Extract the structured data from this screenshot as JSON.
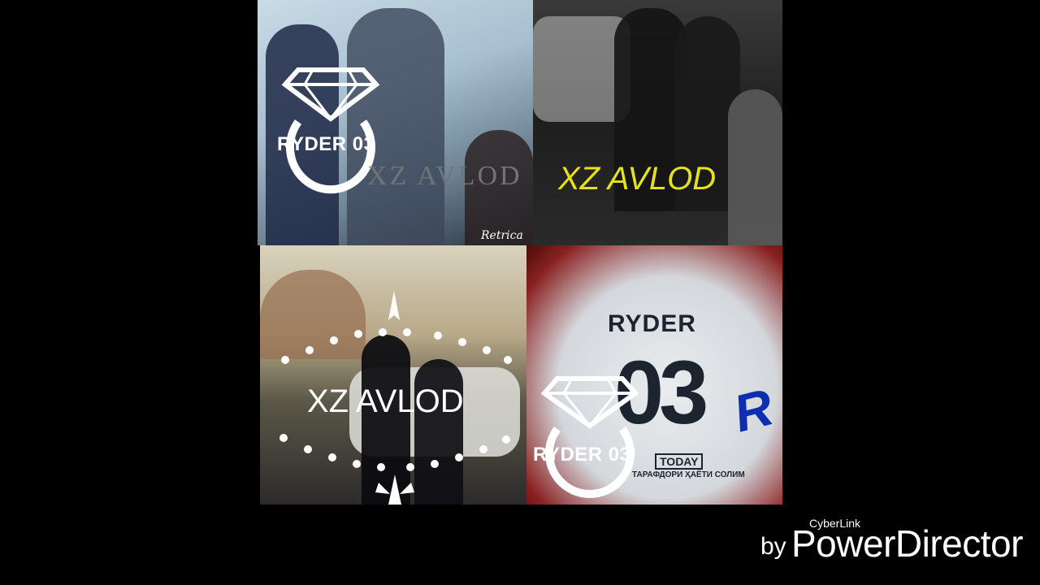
{
  "tiles": [
    {
      "ring_text": "RYDER 03",
      "caption": "XZ AVLOD",
      "watermark": "Retrica"
    },
    {
      "caption": "XZ AVLOD"
    },
    {
      "caption": "XZ AVLOD"
    },
    {
      "ring_text": "RYDER 03",
      "shirt_name": "RYDER",
      "shirt_number": "03",
      "shirt_sponsor": "TODAY",
      "shirt_slogan": "ТАРАФДОРИ ҲАЁТИ СОЛИМ",
      "letter": "R"
    }
  ],
  "branding": {
    "by": "by",
    "company": "CyberLink",
    "product": "PowerDirector"
  },
  "colors": {
    "yellow_caption": "#e6e21a",
    "blue_letter": "#0b2fb0"
  }
}
